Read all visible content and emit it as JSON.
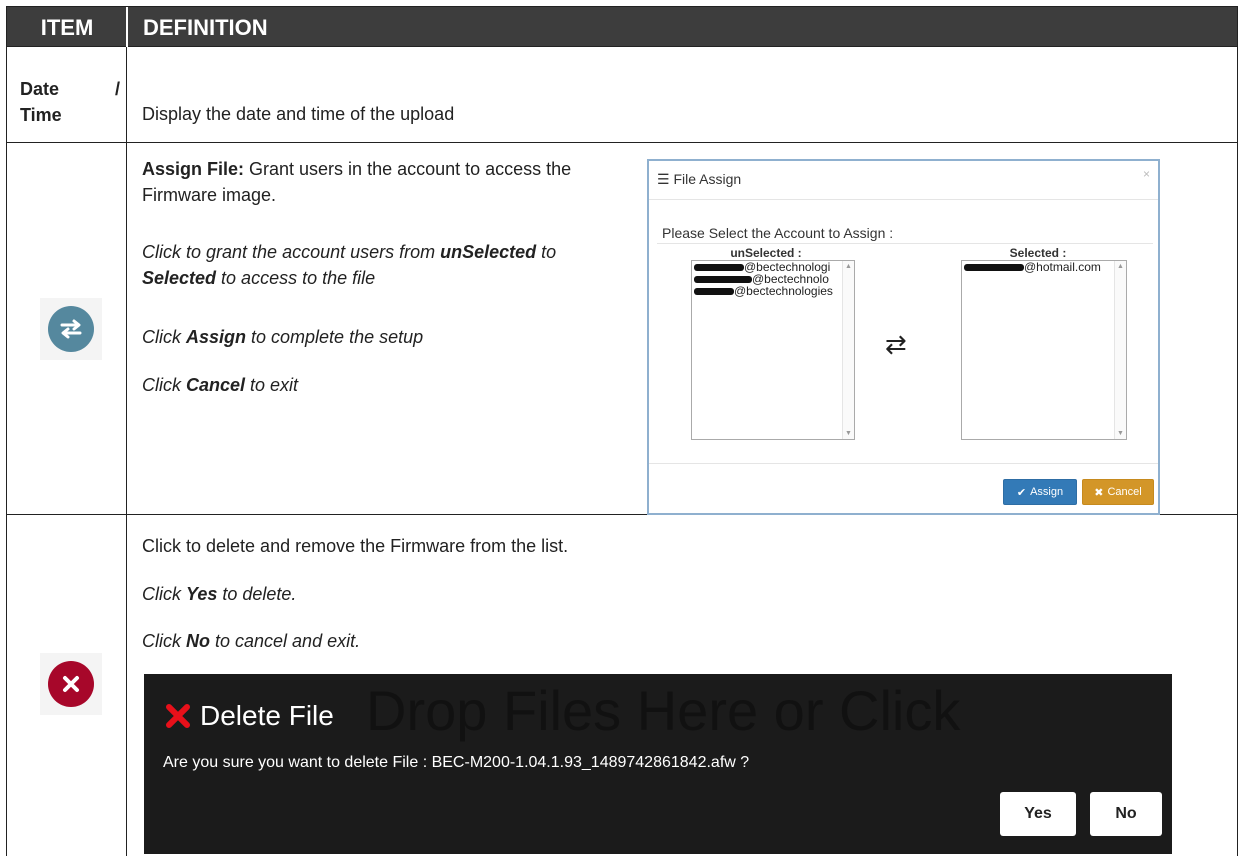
{
  "header": {
    "item": "ITEM",
    "definition": "DEFINITION"
  },
  "row_date": {
    "item_word1": "Date",
    "item_slash": "/",
    "item_word2": "Time",
    "definition": "Display the date and time of the upload"
  },
  "row_assign": {
    "icon": "swap-arrows-icon",
    "title_bold": "Assign File:",
    "title_rest": " Grant users in the account to access the Firmware image.",
    "line2_a": "Click to grant the account users from ",
    "line2_b": "unSelected",
    "line2_c": " to ",
    "line2_d": "Selected",
    "line2_e": " to access to the file",
    "line3_a": "Click ",
    "line3_b": "Assign",
    "line3_c": " to complete the setup",
    "line4_a": "Click ",
    "line4_b": "Cancel",
    "line4_c": " to exit",
    "dialog": {
      "title": "File Assign",
      "close": "×",
      "prompt": "Please Select the Account to Assign :",
      "unselected_label": "unSelected :",
      "selected_label": "Selected :",
      "unselected_items": [
        "@bectechnologi",
        "@bectechnolo",
        "@bectechnologies"
      ],
      "selected_items": [
        "@hotmail.com"
      ],
      "swap_glyph": "⇄",
      "assign_button": "Assign",
      "cancel_button": "Cancel"
    }
  },
  "row_delete": {
    "icon": "close-icon",
    "line1": "Click to delete and remove the Firmware from the list.",
    "line2_a": "Click ",
    "line2_b": "Yes",
    "line2_c": " to delete.",
    "line3_a": "Click ",
    "line3_b": "No",
    "line3_c": " to cancel and exit.",
    "dialog": {
      "watermark": "Drop Files Here or Click",
      "title": "Delete File",
      "message": "Are you sure you want to delete File : BEC-M200-1.04.1.93_1489742861842.afw ?",
      "yes_button": "Yes",
      "no_button": "No"
    }
  },
  "colors": {
    "header_bg": "#3d3d3d",
    "assign_icon": "#55889e",
    "delete_icon": "#a7072a",
    "assign_button": "#337ab7",
    "cancel_button": "#d39628",
    "delete_dialog_bg": "#1b1b1b",
    "delete_x": "#e8101a"
  }
}
